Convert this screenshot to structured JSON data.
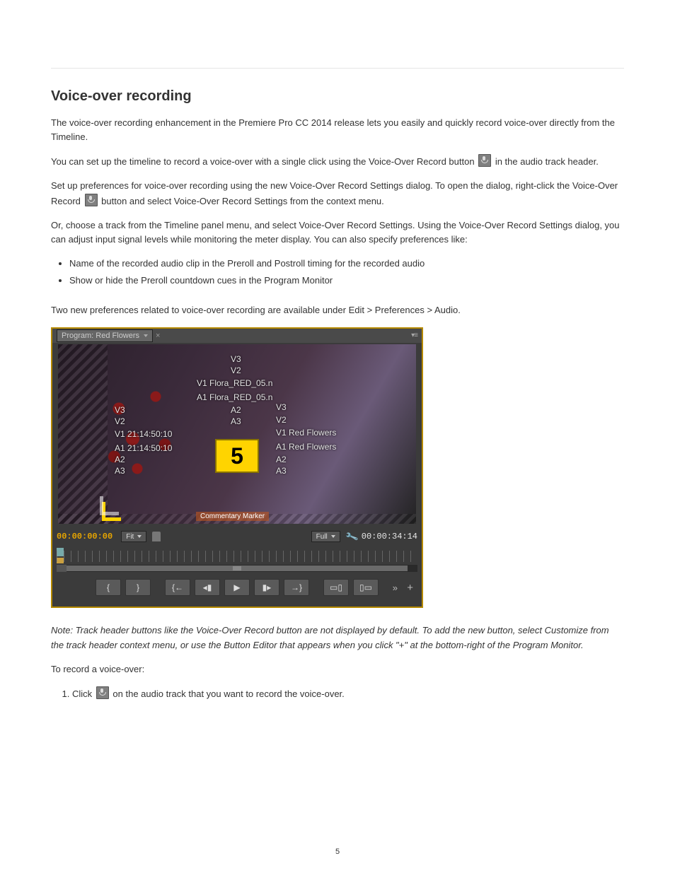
{
  "heading": "Voice-over recording",
  "paragraphs": {
    "intro": "The voice-over recording enhancement in the Premiere Pro CC 2014 release lets you easily and quickly record voice-over directly from the Timeline.",
    "settings_lead": "You can set up the timeline to record a voice-over with a single click using the Voice-Over Record button",
    "settings_tail": "in the audio track header.",
    "prefs_lead": "Set up preferences for voice-over recording using the new Voice-Over Record Settings dialog. To open the dialog, right-click the Voice-Over Record",
    "prefs_tail": "button and select Voice-Over Record Settings from the context menu.",
    "prefs_desc": "Or, choose a track from the Timeline panel menu, and select Voice-Over Record Settings. Using the Voice-Over Record Settings dialog, you can adjust input signal levels while monitoring the meter display. You can also specify preferences like:",
    "two_new_prefs": "Two new preferences related to voice-over recording are available under Edit > Preferences > Audio."
  },
  "bullets": {
    "b1": "Name of the recorded audio clip in the Preroll and Postroll timing for the recorded audio",
    "b2": "Show or hide the Preroll countdown cues in the Program Monitor"
  },
  "note": "Note: Track header buttons like the Voice-Over Record button are not displayed by default. To add the new button, select Customize from the track header context menu, or use the Button Editor that appears when you click \"+\" at the bottom-right of the Program Monitor.",
  "steps": {
    "lead_in": "To record a voice-over:",
    "s1_a": "Click",
    "s1_b": "on the audio track that you want to record the voice-over.",
    "page_num": "5"
  },
  "screenshot": {
    "tab": "Program: Red Flowers",
    "tracks_center": {
      "v3": "V3",
      "v2": "V2",
      "v1": "V1 Flora_RED_05.n",
      "a1": "A1 Flora_RED_05.n",
      "a2": "A2",
      "a3": "A3"
    },
    "tracks_left": {
      "v3": "V3",
      "v2": "V2",
      "v1": "V1 21:14:50:10",
      "a1": "A1 21:14:50:10",
      "a2": "A2",
      "a3": "A3"
    },
    "tracks_right": {
      "v3": "V3",
      "v2": "V2",
      "v1": "V1 Red Flowers",
      "a1": "A1 Red Flowers",
      "a2": "A2",
      "a3": "A3"
    },
    "countdown": "5",
    "commentary": "Commentary Marker",
    "tc_left": "00:00:00:00",
    "tc_right": "00:00:34:14",
    "fit": "Fit",
    "full": "Full"
  }
}
